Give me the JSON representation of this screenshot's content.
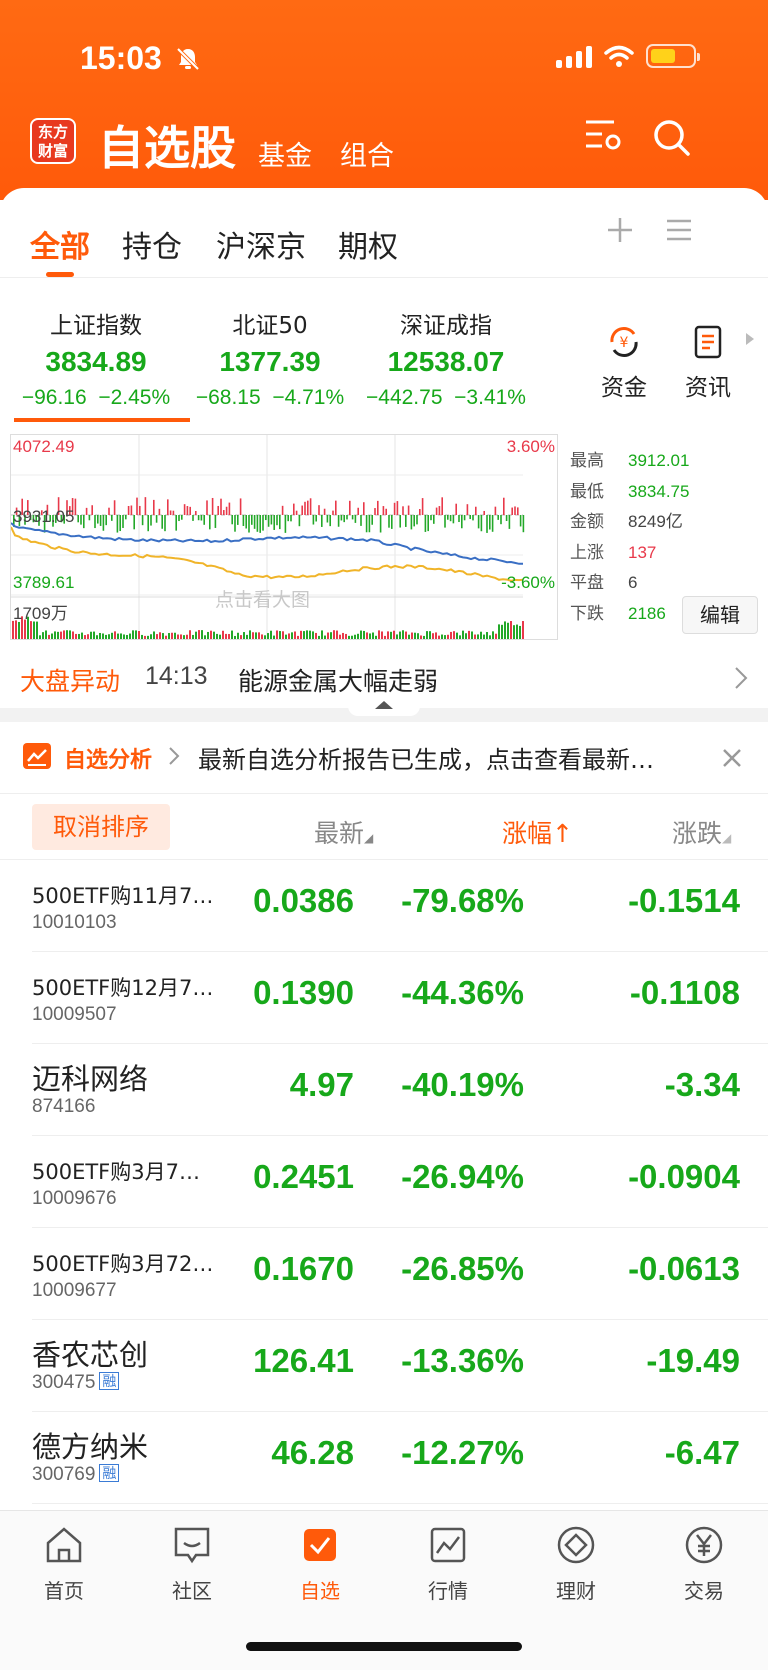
{
  "status_bar": {
    "time": "15:03"
  },
  "header": {
    "logo_text": "东方财富",
    "title": "自选股",
    "tabs": [
      "基金",
      "组合"
    ]
  },
  "tabs": [
    "全部",
    "持仓",
    "沪深京",
    "期权"
  ],
  "indices": [
    {
      "name": "上证指数",
      "price": "3834.89",
      "change": "−96.16",
      "pct": "−2.45%"
    },
    {
      "name": "北证50",
      "price": "1377.39",
      "change": "−68.15",
      "pct": "−4.71%"
    },
    {
      "name": "深证成指",
      "price": "12538.07",
      "change": "−442.75",
      "pct": "−3.41%"
    }
  ],
  "quick_buttons": [
    "资金",
    "资讯"
  ],
  "chart": {
    "high_label": "4072.49",
    "high_pct": "3.60%",
    "mid_label": "3931.05",
    "low_label": "3789.61",
    "low_pct": "-3.60%",
    "volume_label": "1709万",
    "watermark": "点击看大图",
    "colors": {
      "up": "#e8394a",
      "down": "#23a829",
      "index_line": "#3a6fc4",
      "avg_line": "#f0b429"
    }
  },
  "stats": [
    {
      "k": "最高",
      "v": "3912.01",
      "color": "#17a81a"
    },
    {
      "k": "最低",
      "v": "3834.75",
      "color": "#17a81a"
    },
    {
      "k": "金额",
      "v": "8249亿",
      "color": "#444444"
    },
    {
      "k": "上涨",
      "v": "137",
      "color": "#e8394a"
    },
    {
      "k": "平盘",
      "v": "6",
      "color": "#444444"
    },
    {
      "k": "下跌",
      "v": "2186",
      "color": "#17a81a"
    }
  ],
  "edit_label": "编辑",
  "alert": {
    "title": "大盘异动",
    "time": "14:13",
    "text": "能源金属大幅走弱"
  },
  "banner": {
    "title": "自选分析",
    "text": "最新自选分析报告已生成，点击查看最新…"
  },
  "sort_bar": {
    "cancel": "取消排序",
    "col_latest": "最新",
    "col_pct": "涨幅↑",
    "col_chg": "涨跌"
  },
  "stocks": [
    {
      "name": "500ETF购11月7…",
      "code": "10010103",
      "price": "0.0386",
      "pct": "-79.68%",
      "chg": "-0.1514",
      "big": false,
      "rong": false
    },
    {
      "name": "500ETF购12月7…",
      "code": "10009507",
      "price": "0.1390",
      "pct": "-44.36%",
      "chg": "-0.1108",
      "big": false,
      "rong": false
    },
    {
      "name": "迈科网络",
      "code": "874166",
      "price": "4.97",
      "pct": "-40.19%",
      "chg": "-3.34",
      "big": true,
      "rong": false
    },
    {
      "name": "500ETF购3月7…",
      "code": "10009676",
      "price": "0.2451",
      "pct": "-26.94%",
      "chg": "-0.0904",
      "big": false,
      "rong": false
    },
    {
      "name": "500ETF购3月72…",
      "code": "10009677",
      "price": "0.1670",
      "pct": "-26.85%",
      "chg": "-0.0613",
      "big": false,
      "rong": false
    },
    {
      "name": "香农芯创",
      "code": "300475",
      "price": "126.41",
      "pct": "-13.36%",
      "chg": "-19.49",
      "big": true,
      "rong": true
    },
    {
      "name": "德方纳米",
      "code": "300769",
      "price": "46.28",
      "pct": "-12.27%",
      "chg": "-6.47",
      "big": true,
      "rong": true
    }
  ],
  "rong_label": "融",
  "bottom_nav": [
    "首页",
    "社区",
    "自选",
    "行情",
    "理财",
    "交易"
  ]
}
